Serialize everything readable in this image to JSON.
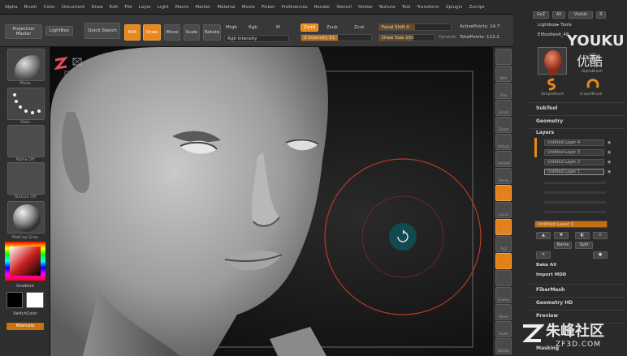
{
  "menu": {
    "items": [
      "Alpha",
      "Brush",
      "Color",
      "Document",
      "Draw",
      "Edit",
      "File",
      "Layer",
      "Light",
      "Macro",
      "Marker",
      "Material",
      "Movie",
      "Picker",
      "Preferences",
      "Render",
      "Stencil",
      "Stroke",
      "Texture",
      "Tool",
      "Transform",
      "Zplugin",
      "Zscript"
    ]
  },
  "toolbar": {
    "projection_master": "Projection Master",
    "lightbox": "LightBox",
    "quick_sketch": "Quick Sketch",
    "edit": "Edit",
    "draw": "Draw",
    "move": "Move",
    "scale": "Scale",
    "rotate": "Rotate",
    "mrgb": "Mrgb",
    "rgb": "Rgb",
    "m": "M",
    "rgb_intensity": "Rgb Intensity",
    "zadd": "Zadd",
    "zsub": "Zsub",
    "zcut": "Zcut",
    "z_intensity": "Z Intensity 51",
    "focal_shift": "Focal Shift 0",
    "draw_size": "Draw Size 150",
    "dynamic": "Dynamic",
    "active_points": "ActivePoints: 14.7",
    "total_points": "TotalPoints: 113.2"
  },
  "left_shelf": {
    "thumb_captions": [
      "Move",
      "Dots",
      "Alpha Off",
      "Texture Off",
      "MatCap Gray"
    ],
    "gradient_label": "Gradient",
    "switch_color_label": "SwitchColor",
    "alternate_label": "Alternate"
  },
  "right_tools": {
    "captions": [
      "",
      "BPR",
      "SPix",
      "Scroll",
      "Zoom",
      "Actual",
      "AAHalf",
      "Persp",
      "Floor",
      "Local",
      "L.Sym",
      "Xyz",
      "",
      "",
      "Frame",
      "Move",
      "Scale",
      "Rotate"
    ]
  },
  "tray": {
    "top_buttons": [
      "GoZ",
      "All",
      "Visible",
      "R"
    ],
    "lightbox_tools": "Lightbox▸ Tools",
    "tool_name": "Elfbodies4_48",
    "tool_thumbs": [
      "AlphaBrush",
      "SimpleBrush",
      "EraserBrush"
    ],
    "subtool": "SubTool",
    "geometry": "Geometry",
    "layers": "Layers",
    "layer_items": [
      "Untitled Layer 4",
      "Untitled Layer 3",
      "Untitled Layer 2",
      "Untitled Layer 1"
    ],
    "layer_current": "Untitled Layer 1",
    "layer_buttons": [
      "Name",
      "Split",
      "Bake All",
      "Import MDD"
    ],
    "fibermesh": "FiberMesh",
    "geometry_hd": "Geometry HD",
    "preview": "Preview",
    "masking": "Masking"
  },
  "watermarks": {
    "youku_en": "YOUKU",
    "youku_cn": "优酷",
    "zf3d_cn": "朱峰社区",
    "zf3d_url": "ZF3D.COM"
  },
  "colors": {
    "accent": "#e7871c",
    "brush_ring": "#b83a2a",
    "cursor_fill": "#124a52"
  }
}
